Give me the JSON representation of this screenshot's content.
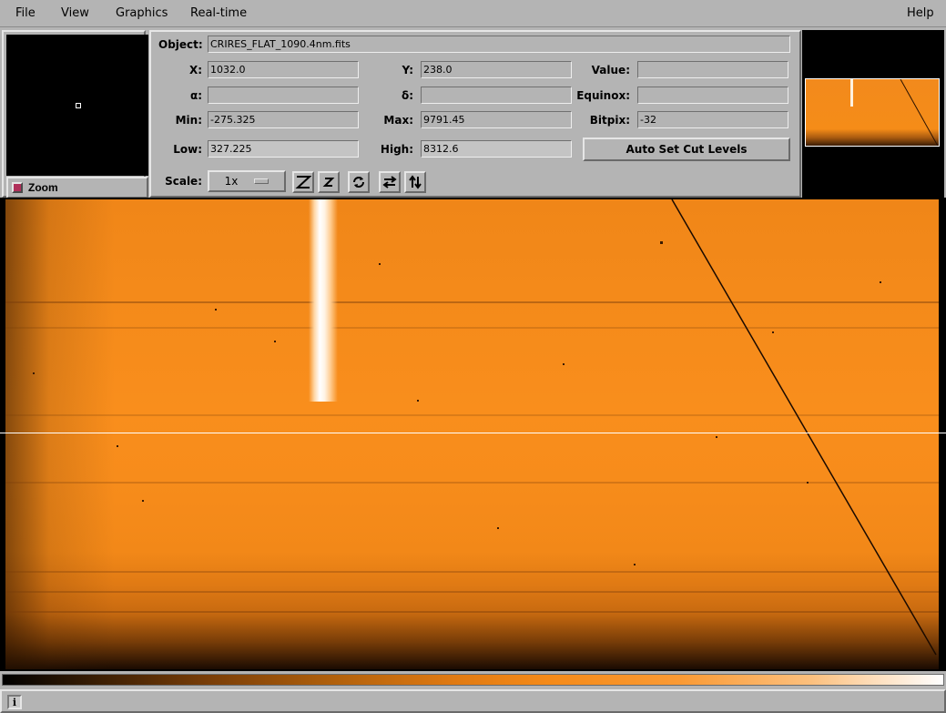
{
  "menubar": {
    "file": "File",
    "view": "View",
    "graphics": "Graphics",
    "realtime": "Real-time",
    "help": "Help"
  },
  "zoom": {
    "toggle_label": "Zoom"
  },
  "info": {
    "object_label": "Object:",
    "object_value": "CRIRES_FLAT_1090.4nm.fits",
    "x_label": "X:",
    "x_value": "1032.0",
    "y_label": "Y:",
    "y_value": "238.0",
    "value_label": "Value:",
    "value_value": "",
    "alpha_label": "α:",
    "alpha_value": "",
    "delta_label": "δ:",
    "delta_value": "",
    "equinox_label": "Equinox:",
    "equinox_value": "",
    "min_label": "Min:",
    "min_value": "-275.325",
    "max_label": "Max:",
    "max_value": "9791.45",
    "bitpix_label": "Bitpix:",
    "bitpix_value": "-32",
    "low_label": "Low:",
    "low_value": "327.225",
    "high_label": "High:",
    "high_value": "8312.6",
    "autocut_label": "Auto Set Cut Levels",
    "scale_label": "Scale:",
    "scale_value": "1x"
  },
  "colors": {
    "image_orange": "#f58c1a",
    "toggle_indicator": "#b0305a",
    "panel_bg": "#b4b4b4"
  },
  "icons": {
    "status": "info-icon",
    "tools": [
      "zoom-out-icon",
      "zoom-in-icon",
      "rotate-icon",
      "flip-x-icon",
      "flip-y-icon"
    ]
  },
  "status": {
    "icon_text": "i",
    "message": ""
  }
}
